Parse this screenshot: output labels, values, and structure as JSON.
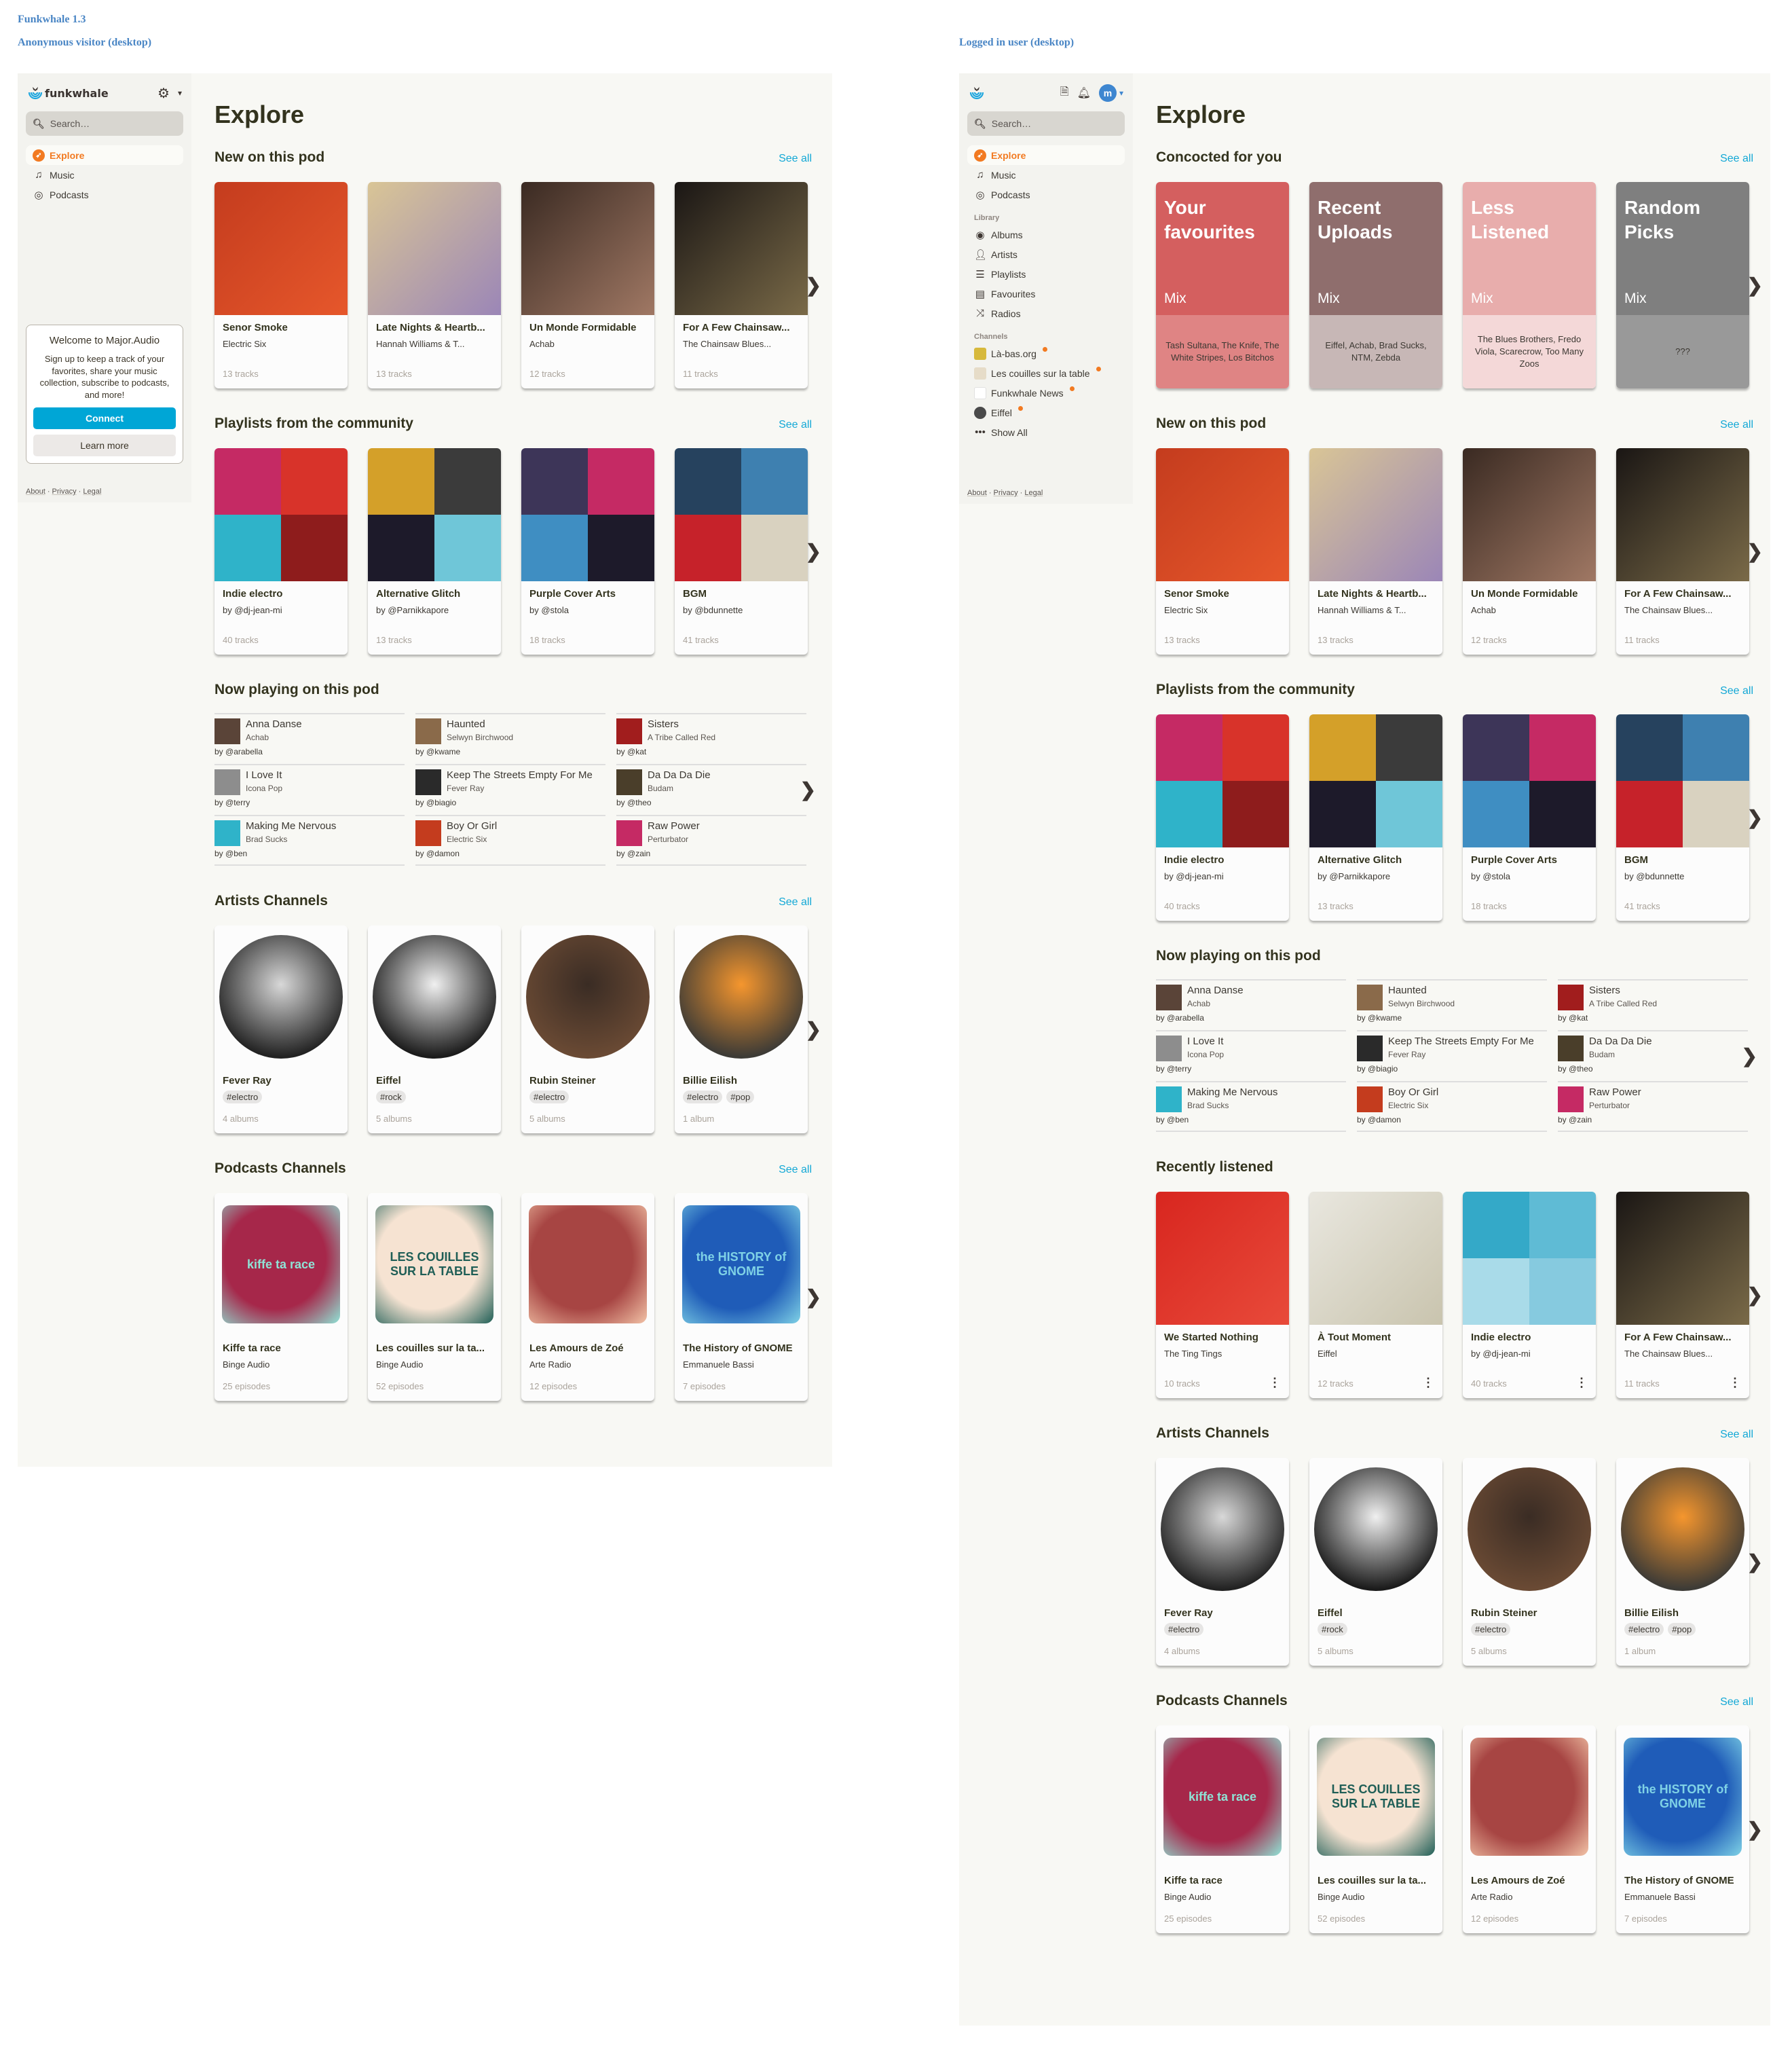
{
  "doc": {
    "title": "Funkwhale 1.3",
    "anon_label": "Anonymous visitor (desktop)",
    "logged_label": "Logged in user (desktop)"
  },
  "colors": {
    "accent_orange": "#f27a21",
    "link_blue": "#13a8d6",
    "connect_blue": "#00a6d6",
    "avatar_blue": "#3e86d0",
    "heading": "#33331e"
  },
  "sidebar": {
    "brand": "funkwhale",
    "search_placeholder": "Search…",
    "nav": [
      {
        "label": "Explore",
        "icon": "compass-icon",
        "active": true
      },
      {
        "label": "Music",
        "icon": "music-note-icon"
      },
      {
        "label": "Podcasts",
        "icon": "podcast-icon"
      }
    ],
    "library_heading": "Library",
    "library": [
      {
        "label": "Albums",
        "icon": "disc-icon"
      },
      {
        "label": "Artists",
        "icon": "user-icon"
      },
      {
        "label": "Playlists",
        "icon": "playlist-icon"
      },
      {
        "label": "Favourites",
        "icon": "audio-file-icon"
      },
      {
        "label": "Radios",
        "icon": "shuffle-icon"
      }
    ],
    "channels_heading": "Channels",
    "channels": [
      {
        "label": "Là-bas.org",
        "unread": true
      },
      {
        "label": "Les couilles sur la table",
        "unread": true
      },
      {
        "label": "Funkwhale News",
        "unread": true
      },
      {
        "label": "Eiffel",
        "unread": true
      }
    ],
    "show_all": "Show All",
    "avatar_initial": "m",
    "welcome": {
      "title": "Welcome to Major.Audio",
      "text": "Sign up to keep a track of your favorites, share your music collection, subscribe to podcasts,  and more!",
      "connect": "Connect",
      "learn_more": "Learn more"
    },
    "footer": [
      "About",
      "Privacy",
      "Legal"
    ],
    "footer_sep": "·"
  },
  "main": {
    "title": "Explore",
    "see_all": "See all",
    "concocted": {
      "title": "Concocted for you",
      "mix_label": "Mix",
      "items": [
        {
          "title": "Your favourites",
          "artists": "Tash Sultana, The Knife, The White Stripes, Los Bitchos",
          "top": "#d45f5f",
          "bottom": "#df8484"
        },
        {
          "title": "Recent Uploads",
          "artists": "Eiffel, Achab, Brad Sucks, NTM, Zebda",
          "top": "#8f6e6d",
          "bottom": "#c7b7b6"
        },
        {
          "title": "Less Listened",
          "artists": "The Blues Brothers, Fredo Viola, Scarecrow, Too Many Zoos",
          "top": "#e8adac",
          "bottom": "#f4d8d8"
        },
        {
          "title": "Random Picks",
          "artists": "???",
          "top": "#7f7f7f",
          "bottom": "#999999"
        }
      ]
    },
    "new_on_pod": {
      "title": "New on this pod",
      "items": [
        {
          "title": "Senor Smoke",
          "artist": "Electric Six",
          "count": "13 tracks",
          "colors": [
            "#c43c1e",
            "#e6572b"
          ]
        },
        {
          "title": "Late Nights & Heartb...",
          "artist": "Hannah Williams & T...",
          "count": "13 tracks",
          "colors": [
            "#d9c596",
            "#9b86b7"
          ]
        },
        {
          "title": "Un Monde Formidable",
          "artist": "Achab",
          "count": "12 tracks",
          "colors": [
            "#3a2a22",
            "#a07864"
          ]
        },
        {
          "title": "For A Few Chainsaw...",
          "artist": "The Chainsaw Blues...",
          "count": "11 tracks",
          "colors": [
            "#1a1614",
            "#7a6a48"
          ]
        }
      ]
    },
    "playlists": {
      "title": "Playlists from the community",
      "items": [
        {
          "title": "Indie electro",
          "owner": "by @dj-jean-mi",
          "count": "40 tracks",
          "mosaic": [
            "#c52a64",
            "#d8332a",
            "#2fb3c9",
            "#8e1c1c"
          ]
        },
        {
          "title": "Alternative Glitch",
          "owner": "by  @Parnikkapore",
          "count": "13 tracks",
          "mosaic": [
            "#d4a029",
            "#3b3b3b",
            "#1d1a2a",
            "#6fc6d8"
          ]
        },
        {
          "title": "Purple Cover Arts",
          "owner": "by @stola",
          "count": "18 tracks",
          "mosaic": [
            "#3d3558",
            "#c52a64",
            "#3f8ec2",
            "#1d1a2a"
          ]
        },
        {
          "title": "BGM",
          "owner": "by @bdunnette",
          "count": "41 tracks",
          "mosaic": [
            "#26425e",
            "#3e80b0",
            "#c6222a",
            "#d9d2c0"
          ]
        }
      ]
    },
    "now_playing": {
      "title": "Now playing on this pod",
      "items": [
        {
          "title": "Anna Danse",
          "artist": "Achab",
          "by": "by @arabella",
          "color": "#5a4438"
        },
        {
          "title": "Haunted",
          "artist": "Selwyn Birchwood",
          "by": "by @kwame",
          "color": "#8a6a4a"
        },
        {
          "title": "Sisters",
          "artist": "A Tribe Called Red",
          "by": "by @kat",
          "color": "#a11d1d"
        },
        {
          "title": "I Love It",
          "artist": "Icona Pop",
          "by": "by @terry",
          "color": "#8d8d8d"
        },
        {
          "title": "Keep The Streets Empty For Me",
          "artist": "Fever Ray",
          "by": "by @biagio",
          "color": "#2a2a2a"
        },
        {
          "title": "Da Da Da Die",
          "artist": "Budam",
          "by": "by @theo",
          "color": "#4a3e2a"
        },
        {
          "title": "Making Me Nervous",
          "artist": "Brad Sucks",
          "by": "by @ben",
          "color": "#2fb3c9"
        },
        {
          "title": "Boy Or Girl",
          "artist": "Electric Six",
          "by": "by @damon",
          "color": "#c43c1e"
        },
        {
          "title": "Raw Power",
          "artist": "Perturbator",
          "by": "by @zain",
          "color": "#c52a64"
        }
      ]
    },
    "recently_listened": {
      "title": "Recently listened",
      "items": [
        {
          "title": "We Started Nothing",
          "artist": "The Ting Tings",
          "count": "10 tracks",
          "colors": [
            "#d8261f",
            "#e84a3a"
          ]
        },
        {
          "title": "À Tout Moment",
          "artist": "Eiffel",
          "count": "12 tracks",
          "colors": [
            "#e9e7df",
            "#c9c4ae"
          ]
        },
        {
          "title": "Indie electro",
          "artist": "by @dj-jean-mi",
          "count": "40 tracks",
          "mosaic": [
            "#34a9c8",
            "#5fbbd5",
            "#a9dbe9",
            "#86cadf"
          ]
        },
        {
          "title": "For A Few Chainsaw...",
          "artist": "The Chainsaw Blues...",
          "count": "11 tracks",
          "colors": [
            "#1a1614",
            "#7a6a48"
          ]
        }
      ]
    },
    "artists": {
      "title": "Artists Channels",
      "items": [
        {
          "name": "Fever Ray",
          "tags": [
            "#electro"
          ],
          "count": "4 albums",
          "colors": [
            "#d8d8d8",
            "#222222"
          ]
        },
        {
          "name": "Eiffel",
          "tags": [
            "#rock"
          ],
          "count": "5 albums",
          "colors": [
            "#f0f0f0",
            "#1b1b1b"
          ]
        },
        {
          "name": "Rubin Steiner",
          "tags": [
            "#electro"
          ],
          "count": "5 albums",
          "colors": [
            "#3a2c24",
            "#6a4a34"
          ]
        },
        {
          "name": "Billie Eilish",
          "tags": [
            "#electro",
            "#pop"
          ],
          "count": "1 album",
          "colors": [
            "#f5962e",
            "#3d3b36"
          ]
        }
      ]
    },
    "podcasts": {
      "title": "Podcasts Channels",
      "items": [
        {
          "title": "Kiffe ta race",
          "author": "Binge Audio",
          "count": "25 episodes",
          "bg": "#a6274a",
          "accent": "#8fe3d6",
          "cover_text": "kiffe ta race"
        },
        {
          "title": "Les couilles sur la ta...",
          "author": "Binge Audio",
          "count": "52 episodes",
          "bg": "#f6e3d2",
          "accent": "#1f5e56",
          "cover_text": "LES COUILLES SUR LA TABLE"
        },
        {
          "title": "Les Amours de Zoé",
          "author": "Arte Radio",
          "count": "12 episodes",
          "bg": "#a74543",
          "accent": "#f2c3a7",
          "cover_text": ""
        },
        {
          "title": "The History of GNOME",
          "author": "Emmanuele Bassi",
          "count": "7 episodes",
          "bg": "#1f5cb8",
          "accent": "#7fd2e6",
          "cover_text": "the HISTORY of GNOME"
        }
      ]
    }
  }
}
